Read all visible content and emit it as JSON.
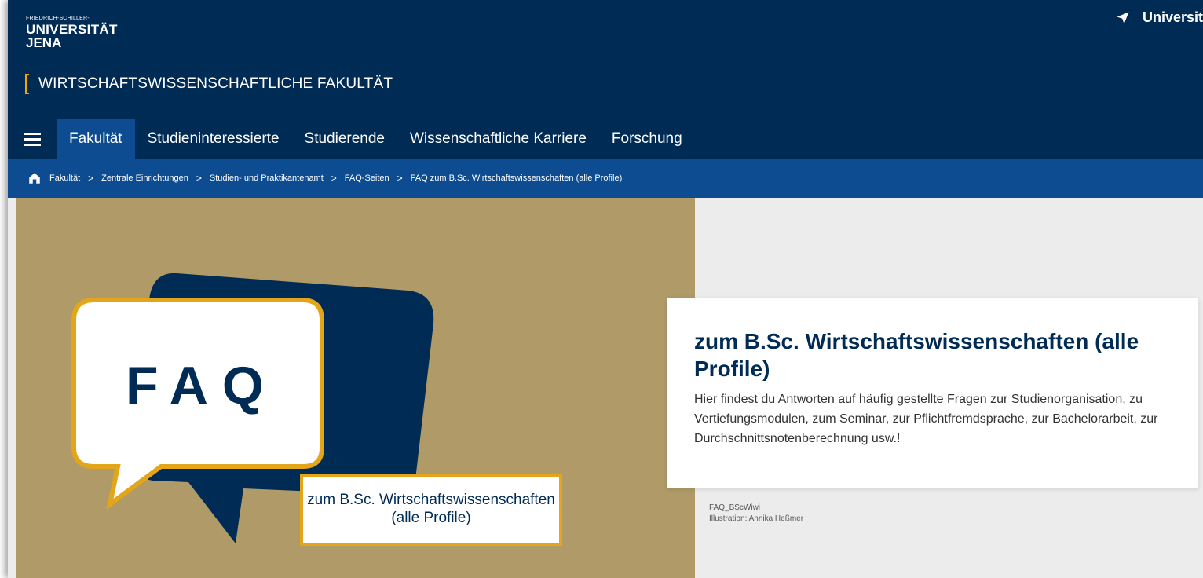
{
  "header": {
    "logo_line1": "FRIEDRICH-SCHILLER-",
    "logo_line2": "UNIVERSITÄT",
    "logo_line3": "JENA",
    "uni_link": "Universit",
    "faculty": "WIRTSCHAFTSWISSENSCHAFTLICHE FAKULTÄT"
  },
  "nav": {
    "items": [
      "Fakultät",
      "Studieninteressierte",
      "Studierende",
      "Wissenschaftliche Karriere",
      "Forschung"
    ],
    "active": "Fakultät"
  },
  "breadcrumb": {
    "items": [
      "Fakultät",
      "Zentrale Einrichtungen",
      "Studien- und Praktikantenamt",
      "FAQ-Seiten",
      "FAQ zum B.Sc. Wirtschaftswissenschaften (alle Profile)"
    ],
    "separator": ">"
  },
  "hero": {
    "faq_text": "FAQ",
    "label": "zum B.Sc. Wirtschaftswissenschaften (alle Profile)",
    "colors": {
      "background": "#af9a68",
      "navy": "#002b55",
      "gold": "#e3a61b"
    }
  },
  "card": {
    "title": "zum B.Sc. Wirtschaftswissenschaften (alle Profile)",
    "text": "Hier findest du Antworten auf häufig gestellte Fragen zur Studienorga­nisation, zu Vertiefungsmodulen, zum Seminar, zur Pflichtfremdspra­che, zur Bachelorarbeit, zur Durchschnittsnotenberechnung usw.!"
  },
  "caption": {
    "line1": "FAQ_BScWiwi",
    "line2": "Illustration: Annika Heßmer"
  },
  "colors": {
    "header_bg": "#002b55",
    "nav_active": "#0d4c91",
    "accent": "#f0a800"
  }
}
